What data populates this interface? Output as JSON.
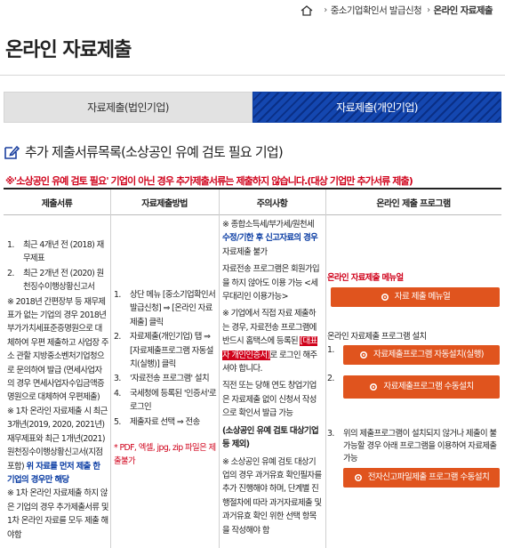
{
  "breadcrumb": {
    "sep1": "›",
    "item1": "중소기업확인서 발급신청",
    "sep2": "›",
    "current": "온라인 자료제출"
  },
  "page_title": "온라인 자료제출",
  "tabs": [
    {
      "label": "자료제출(법인기업)",
      "active": false
    },
    {
      "label": "자료제출(개인기업)",
      "active": true
    }
  ],
  "section_title": "추가 제출서류목록(소상공인 유예 검토 필요 기업)",
  "notice": "※'소상공인 유예 검토 필요' 기업이 아닌 경우 추가제출서류는 제출하지 않습니다.(대상 기업만 추가서류 제출)",
  "table_headers": [
    "제출서류",
    "자료제출방법",
    "주의사항",
    "온라인 제출 프로그램"
  ],
  "col1": {
    "items": [
      {
        "n": "1.",
        "text": "최근 4개년 전 (2018) 재무제표"
      },
      {
        "n": "2.",
        "text": "최근 2개년 전 (2020) 원천징수이행상황신고서"
      }
    ],
    "note1": "※ 2018년 간편장부 등 재무제표가 없는 기업의 경우 2018년 부가가치세표준증명원으로 대체하여 우편 제출하고 사업장 주소 관할 지방중소벤처기업청으로 문의하여 발급 (면세사업자의 경우 면세사업자수입금액증명원으로 대체하여 우편제출)",
    "note2_pre": "※ 1차 온라인 자료제출 시 최근 3개년(2019, 2020, 2021년) 재무제표와 최근 1개년(2021) 원천징수이행상황신고서(지점포함) ",
    "note2_blue": "위 자료를 먼저 제출 한 기업의 경우만 해당",
    "note3": "※ 1차 온라인 자료제출 하지 않은 기업의 경우 추가제출서류 및 1차 온라인 자료를 모두 제출 해야함"
  },
  "col2": {
    "items": [
      {
        "n": "1.",
        "text": "상단 메뉴 [중소기업확인서 발급신청] ⇒ [온라인 자료제출] 클릭"
      },
      {
        "n": "2.",
        "text": "자료제출(개인기업) 탭 ⇒ [자료제출프로그램 자동설치(실행)] 클릭"
      },
      {
        "n": "3.",
        "text": "'자료전송 프로그램' 설치"
      },
      {
        "n": "4.",
        "text": "국세청에 등록된 '인증서'로 로그인"
      },
      {
        "n": "5.",
        "text": "제출자료 선택 ⇒ 전송"
      }
    ],
    "note": "* PDF, 엑셀, jpg, zip 파일은 제출불가"
  },
  "col3": {
    "p1_pre": "※ 종합소득세/부가세/원천세 ",
    "p1_blue": "수정/기한 후 신고자료의 경우",
    "p1_post": " 자료제출 불가",
    "p2": "자료전송 프로그램은 회원가입을 하지 않아도 이용 가능 <세무대리인 이용가능>",
    "p3_pre": "※ 기업에서 직접 자료 제출하는 경우, 자료전송 프로그램에 반드시 홈택스에 등록된 ",
    "p3_red": "[대표자 개인인증서]",
    "p3_post": "로 로그인 해주셔야 합니다.",
    "p4": "직전 또는 당해 연도 창업기업은 자료제출 없이 신청서 작성으로 확인서 발급 가능",
    "p5": "(소상공인 유예 검토 대상기업 등 제외)",
    "p6": "※ 소상공인 유예 검토 대상기업의 경우 과거유효 확인필자를 추가 진행해야 하며, 단계별 진행절차에 따라 과거자료제출 및 과거유효 확인 위한 선택 항목을 작성해야 함"
  },
  "col4": {
    "manual_title": "온라인 자료제출 메뉴얼",
    "manual_btn": "자료 제출 메뉴얼",
    "install_title": "온라인 자료제출 프로그램 설치",
    "btn1_n": "1.",
    "btn1": "자료제출프로그램 자동설치(실행)",
    "btn2_n": "2.",
    "btn2": "자료제출프로그램 수동설치",
    "item3_n": "3.",
    "item3": "위의 제출프로그램이 설치되지 않거나 제출이 불가능할 경우 아래 프로그램을 이용하여 자료제출 가능",
    "btn3": "전자신고파일제출 프로그램 수동설치"
  },
  "colors": {
    "active_tab": "#0a2f86",
    "accent_red": "#d0021b",
    "button_orange": "#e0541e",
    "link_blue": "#0a3ca3"
  },
  "icons": [
    "home-icon",
    "pencil-icon",
    "gear-icon"
  ]
}
